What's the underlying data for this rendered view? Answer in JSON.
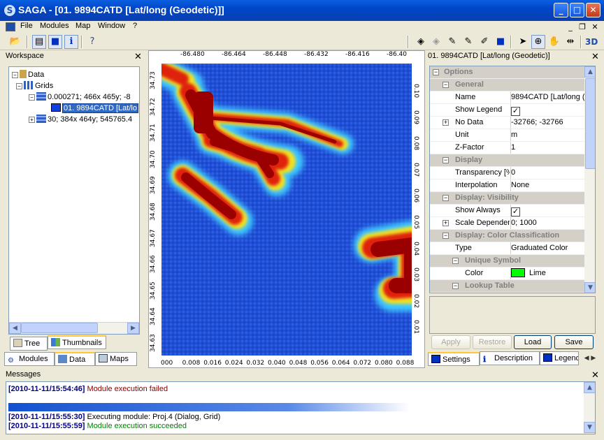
{
  "window": {
    "title": "SAGA - [01. 9894CATD [Lat/long (Geodetic)]]",
    "icon": "saga-logo-icon"
  },
  "menu": [
    "File",
    "Modules",
    "Map",
    "Window",
    "?"
  ],
  "workspace": {
    "title": "Workspace",
    "tree": {
      "root": "Data",
      "grids": "Grids",
      "system1": "0.000271; 466x 465y; -8",
      "grid1": "01. 9894CATD [Lat/lo",
      "system2": "30; 384x 464y; 545765.4"
    },
    "subtabs": [
      "Tree",
      "Thumbnails"
    ],
    "tabs": [
      "Modules",
      "Data",
      "Maps"
    ]
  },
  "map": {
    "top_ticks": [
      "-86.480",
      "-86.464",
      "-86.448",
      "-86.432",
      "-86.416",
      "-86.40"
    ],
    "bottom_ticks": [
      "000",
      "0.008",
      "0.016",
      "0.024",
      "0.032",
      "0.040",
      "0.048",
      "0.056",
      "0.064",
      "0.072",
      "0.080",
      "0.088"
    ],
    "left_ticks": [
      "34.73",
      "34.72",
      "34.71",
      "34.70",
      "34.69",
      "34.68",
      "34.67",
      "34.66",
      "34.65",
      "34.64",
      "34.63"
    ],
    "right_ticks": [
      "0.10",
      "0.09",
      "0.08",
      "0.07",
      "0.06",
      "0.05",
      "0.04",
      "0.03",
      "0.02",
      "0.01"
    ]
  },
  "settings_panel": {
    "title": "01. 9894CATD [Lat/long (Geodetic)]",
    "rows": {
      "options": "Options",
      "general": "General",
      "name_k": "Name",
      "name_v": "9894CATD [Lat/long (",
      "legend_k": "Show Legend",
      "legend_v": "✓",
      "nodata_k": "No Data",
      "nodata_v": "-32766; -32766",
      "unit_k": "Unit",
      "unit_v": "m",
      "zfactor_k": "Z-Factor",
      "zfactor_v": "1",
      "display": "Display",
      "transp_k": "Transparency [%",
      "transp_v": "0",
      "interp_k": "Interpolation",
      "interp_v": "None",
      "visibility": "Display: Visibility",
      "showalways_k": "Show Always",
      "showalways_v": "✓",
      "scaledep_k": "Scale Dependen",
      "scaledep_v": "0; 1000",
      "colorclass": "Display: Color Classification",
      "type_k": "Type",
      "type_v": "Graduated Color",
      "unique": "Unique Symbol",
      "color_k": "Color",
      "color_v": "Lime",
      "lookup": "Lookup Table"
    },
    "buttons": {
      "apply": "Apply",
      "restore": "Restore",
      "load": "Load",
      "save": "Save"
    },
    "tabs": [
      "Settings",
      "Description",
      "Legend"
    ],
    "swatch_color": "#00ff00"
  },
  "messages": {
    "title": "Messages",
    "lines": [
      {
        "time": "[2010-11-11/15:54:46]",
        "text": "Module execution failed",
        "color": "#800000"
      },
      {
        "time": "[2010-11-11/15:55:30]",
        "text": "Executing module: Proj.4 (Dialog, Grid)",
        "color": "#000000"
      },
      {
        "time": "[2010-11-11/15:55:59]",
        "text": "Module execution succeeded",
        "color": "#008000"
      }
    ],
    "progress": 0.7
  }
}
